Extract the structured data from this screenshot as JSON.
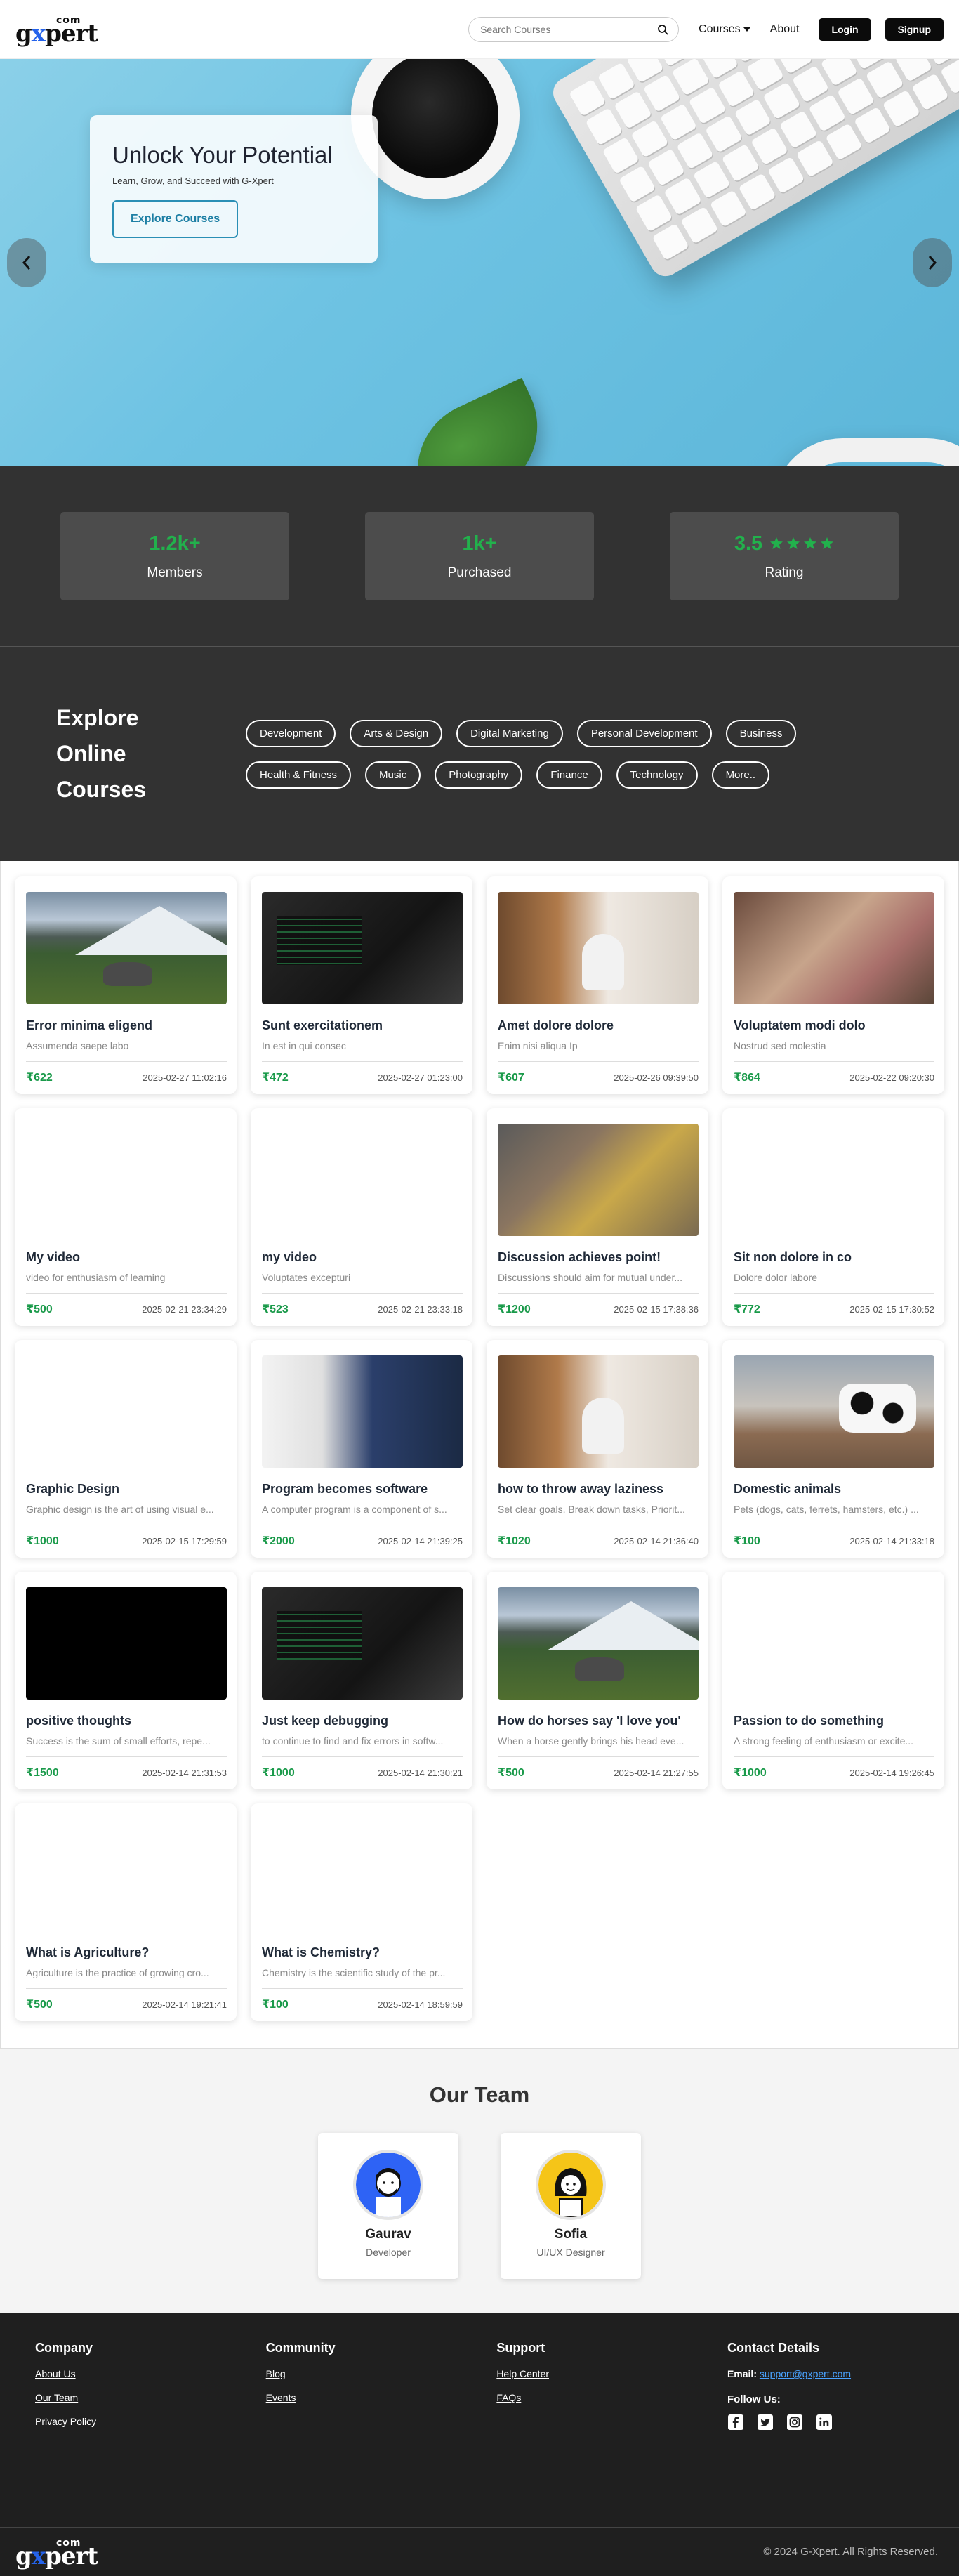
{
  "brand": {
    "com": "com",
    "word_pre": "g",
    "word_x": "x",
    "word_post": "pert"
  },
  "nav": {
    "search_placeholder": "Search Courses",
    "courses": "Courses",
    "about": "About",
    "login": "Login",
    "signup": "Signup"
  },
  "hero": {
    "title": "Unlock Your Potential",
    "subtitle": "Learn, Grow, and Succeed with G-Xpert",
    "cta": "Explore Courses"
  },
  "stats": [
    {
      "value": "1.2k+",
      "label": "Members"
    },
    {
      "value": "1k+",
      "label": "Purchased"
    },
    {
      "value": "3.5",
      "label": "Rating",
      "stars": 4
    }
  ],
  "explore": {
    "title_line1": "Explore",
    "title_line2": "Online",
    "title_line3": "Courses",
    "tags": [
      "Development",
      "Arts & Design",
      "Digital Marketing",
      "Personal Development",
      "Business",
      "Health & Fitness",
      "Music",
      "Photography",
      "Finance",
      "Technology",
      "More.."
    ]
  },
  "courses": [
    {
      "title": "Error minima eligend",
      "desc": "Assumenda saepe labo",
      "price": "₹622",
      "date": "2025-02-27 11:02:16",
      "img": "mountain"
    },
    {
      "title": "Sunt exercitationem",
      "desc": "In est in qui consec",
      "price": "₹472",
      "date": "2025-02-27 01:23:00",
      "img": "laptop"
    },
    {
      "title": "Amet dolore dolore",
      "desc": "Enim nisi aliqua Ip",
      "price": "₹607",
      "date": "2025-02-26 09:39:50",
      "img": "room"
    },
    {
      "title": "Voluptatem modi dolo",
      "desc": "Nostrud sed molestia",
      "price": "₹864",
      "date": "2025-02-22 09:20:30",
      "img": "lab"
    },
    {
      "title": "My video",
      "desc": "video for enthusiasm of learning",
      "price": "₹500",
      "date": "2025-02-21 23:34:29",
      "img": "blank"
    },
    {
      "title": "my video",
      "desc": "Voluptates excepturi",
      "price": "₹523",
      "date": "2025-02-21 23:33:18",
      "img": "blank"
    },
    {
      "title": "Discussion achieves point!",
      "desc": "Discussions should aim for mutual under...",
      "price": "₹1200",
      "date": "2025-02-15 17:38:36",
      "img": "meeting"
    },
    {
      "title": "Sit non dolore in co",
      "desc": "Dolore dolor labore",
      "price": "₹772",
      "date": "2025-02-15 17:30:52",
      "img": "blank"
    },
    {
      "title": "Graphic Design",
      "desc": "Graphic design is the art of using visual e...",
      "price": "₹1000",
      "date": "2025-02-15 17:29:59",
      "img": "blank"
    },
    {
      "title": "Program becomes software",
      "desc": "A computer program is a component of s...",
      "price": "₹2000",
      "date": "2025-02-14 21:39:25",
      "img": "coder"
    },
    {
      "title": "how to throw away laziness",
      "desc": "Set clear goals, Break down tasks, Priorit...",
      "price": "₹1020",
      "date": "2025-02-14 21:36:40",
      "img": "room"
    },
    {
      "title": "Domestic animals",
      "desc": "Pets (dogs, cats, ferrets, hamsters, etc.) ...",
      "price": "₹100",
      "date": "2025-02-14 21:33:18",
      "img": "cow"
    },
    {
      "title": "positive thoughts",
      "desc": "Success is the sum of small efforts, repe...",
      "price": "₹1500",
      "date": "2025-02-14 21:31:53",
      "img": "black"
    },
    {
      "title": "Just keep debugging",
      "desc": "to continue to find and fix errors in softw...",
      "price": "₹1000",
      "date": "2025-02-14 21:30:21",
      "img": "laptop"
    },
    {
      "title": "How do horses say 'I love you'",
      "desc": "When a horse gently brings his head eve...",
      "price": "₹500",
      "date": "2025-02-14 21:27:55",
      "img": "mountain"
    },
    {
      "title": "Passion to do something",
      "desc": "A strong feeling of enthusiasm or excite...",
      "price": "₹1000",
      "date": "2025-02-14 19:26:45",
      "img": "blank"
    },
    {
      "title": "What is Agriculture?",
      "desc": "Agriculture is the practice of growing cro...",
      "price": "₹500",
      "date": "2025-02-14 19:21:41",
      "img": "blank"
    },
    {
      "title": "What is Chemistry?",
      "desc": "Chemistry is the scientific study of the pr...",
      "price": "₹100",
      "date": "2025-02-14 18:59:59",
      "img": "blank"
    }
  ],
  "team": {
    "title": "Our Team",
    "members": [
      {
        "name": "Gaurav",
        "role": "Developer",
        "color": "#2e63f5"
      },
      {
        "name": "Sofia",
        "role": "UI/UX Designer",
        "color": "#f5c518"
      }
    ]
  },
  "footer": {
    "company": {
      "title": "Company",
      "links": [
        "About Us",
        "Our Team",
        "Privacy Policy"
      ]
    },
    "community": {
      "title": "Community",
      "links": [
        "Blog",
        "Events"
      ]
    },
    "support": {
      "title": "Support",
      "links": [
        "Help Center",
        "FAQs"
      ]
    },
    "contact": {
      "title": "Contact Details",
      "email_label": "Email:",
      "email": "support@gxpert.com",
      "follow": "Follow Us:"
    },
    "social_icons": [
      "facebook-icon",
      "twitter-icon",
      "instagram-icon",
      "linkedin-icon"
    ],
    "copyright": "© 2024 G-Xpert. All Rights Reserved."
  },
  "colors": {
    "accent_green": "#22b14c",
    "dark_bg": "#323232",
    "footer_bg": "#1f1f1f",
    "link_blue": "#4aa3ff",
    "logo_x": "#2563eb"
  }
}
